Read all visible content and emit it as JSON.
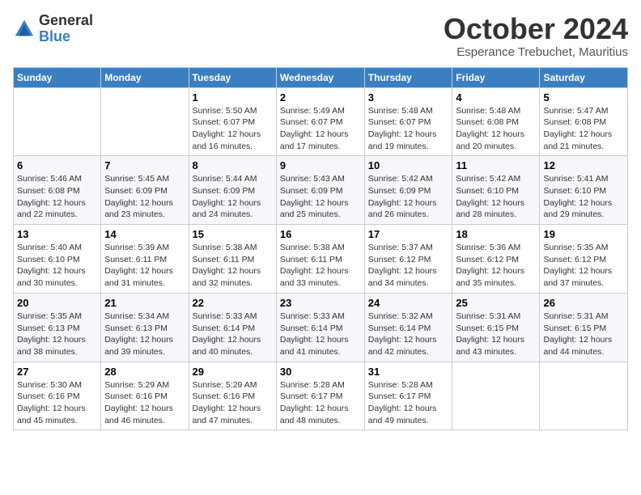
{
  "header": {
    "logo_general": "General",
    "logo_blue": "Blue",
    "month_title": "October 2024",
    "location": "Esperance Trebuchet, Mauritius"
  },
  "days_of_week": [
    "Sunday",
    "Monday",
    "Tuesday",
    "Wednesday",
    "Thursday",
    "Friday",
    "Saturday"
  ],
  "weeks": [
    [
      {
        "day": "",
        "info": ""
      },
      {
        "day": "",
        "info": ""
      },
      {
        "day": "1",
        "sunrise": "5:50 AM",
        "sunset": "6:07 PM",
        "daylight": "12 hours and 16 minutes."
      },
      {
        "day": "2",
        "sunrise": "5:49 AM",
        "sunset": "6:07 PM",
        "daylight": "12 hours and 17 minutes."
      },
      {
        "day": "3",
        "sunrise": "5:48 AM",
        "sunset": "6:07 PM",
        "daylight": "12 hours and 19 minutes."
      },
      {
        "day": "4",
        "sunrise": "5:48 AM",
        "sunset": "6:08 PM",
        "daylight": "12 hours and 20 minutes."
      },
      {
        "day": "5",
        "sunrise": "5:47 AM",
        "sunset": "6:08 PM",
        "daylight": "12 hours and 21 minutes."
      }
    ],
    [
      {
        "day": "6",
        "sunrise": "5:46 AM",
        "sunset": "6:08 PM",
        "daylight": "12 hours and 22 minutes."
      },
      {
        "day": "7",
        "sunrise": "5:45 AM",
        "sunset": "6:09 PM",
        "daylight": "12 hours and 23 minutes."
      },
      {
        "day": "8",
        "sunrise": "5:44 AM",
        "sunset": "6:09 PM",
        "daylight": "12 hours and 24 minutes."
      },
      {
        "day": "9",
        "sunrise": "5:43 AM",
        "sunset": "6:09 PM",
        "daylight": "12 hours and 25 minutes."
      },
      {
        "day": "10",
        "sunrise": "5:42 AM",
        "sunset": "6:09 PM",
        "daylight": "12 hours and 26 minutes."
      },
      {
        "day": "11",
        "sunrise": "5:42 AM",
        "sunset": "6:10 PM",
        "daylight": "12 hours and 28 minutes."
      },
      {
        "day": "12",
        "sunrise": "5:41 AM",
        "sunset": "6:10 PM",
        "daylight": "12 hours and 29 minutes."
      }
    ],
    [
      {
        "day": "13",
        "sunrise": "5:40 AM",
        "sunset": "6:10 PM",
        "daylight": "12 hours and 30 minutes."
      },
      {
        "day": "14",
        "sunrise": "5:39 AM",
        "sunset": "6:11 PM",
        "daylight": "12 hours and 31 minutes."
      },
      {
        "day": "15",
        "sunrise": "5:38 AM",
        "sunset": "6:11 PM",
        "daylight": "12 hours and 32 minutes."
      },
      {
        "day": "16",
        "sunrise": "5:38 AM",
        "sunset": "6:11 PM",
        "daylight": "12 hours and 33 minutes."
      },
      {
        "day": "17",
        "sunrise": "5:37 AM",
        "sunset": "6:12 PM",
        "daylight": "12 hours and 34 minutes."
      },
      {
        "day": "18",
        "sunrise": "5:36 AM",
        "sunset": "6:12 PM",
        "daylight": "12 hours and 35 minutes."
      },
      {
        "day": "19",
        "sunrise": "5:35 AM",
        "sunset": "6:12 PM",
        "daylight": "12 hours and 37 minutes."
      }
    ],
    [
      {
        "day": "20",
        "sunrise": "5:35 AM",
        "sunset": "6:13 PM",
        "daylight": "12 hours and 38 minutes."
      },
      {
        "day": "21",
        "sunrise": "5:34 AM",
        "sunset": "6:13 PM",
        "daylight": "12 hours and 39 minutes."
      },
      {
        "day": "22",
        "sunrise": "5:33 AM",
        "sunset": "6:14 PM",
        "daylight": "12 hours and 40 minutes."
      },
      {
        "day": "23",
        "sunrise": "5:33 AM",
        "sunset": "6:14 PM",
        "daylight": "12 hours and 41 minutes."
      },
      {
        "day": "24",
        "sunrise": "5:32 AM",
        "sunset": "6:14 PM",
        "daylight": "12 hours and 42 minutes."
      },
      {
        "day": "25",
        "sunrise": "5:31 AM",
        "sunset": "6:15 PM",
        "daylight": "12 hours and 43 minutes."
      },
      {
        "day": "26",
        "sunrise": "5:31 AM",
        "sunset": "6:15 PM",
        "daylight": "12 hours and 44 minutes."
      }
    ],
    [
      {
        "day": "27",
        "sunrise": "5:30 AM",
        "sunset": "6:16 PM",
        "daylight": "12 hours and 45 minutes."
      },
      {
        "day": "28",
        "sunrise": "5:29 AM",
        "sunset": "6:16 PM",
        "daylight": "12 hours and 46 minutes."
      },
      {
        "day": "29",
        "sunrise": "5:29 AM",
        "sunset": "6:16 PM",
        "daylight": "12 hours and 47 minutes."
      },
      {
        "day": "30",
        "sunrise": "5:28 AM",
        "sunset": "6:17 PM",
        "daylight": "12 hours and 48 minutes."
      },
      {
        "day": "31",
        "sunrise": "5:28 AM",
        "sunset": "6:17 PM",
        "daylight": "12 hours and 49 minutes."
      },
      {
        "day": "",
        "info": ""
      },
      {
        "day": "",
        "info": ""
      }
    ]
  ],
  "labels": {
    "sunrise": "Sunrise:",
    "sunset": "Sunset:",
    "daylight": "Daylight:"
  }
}
